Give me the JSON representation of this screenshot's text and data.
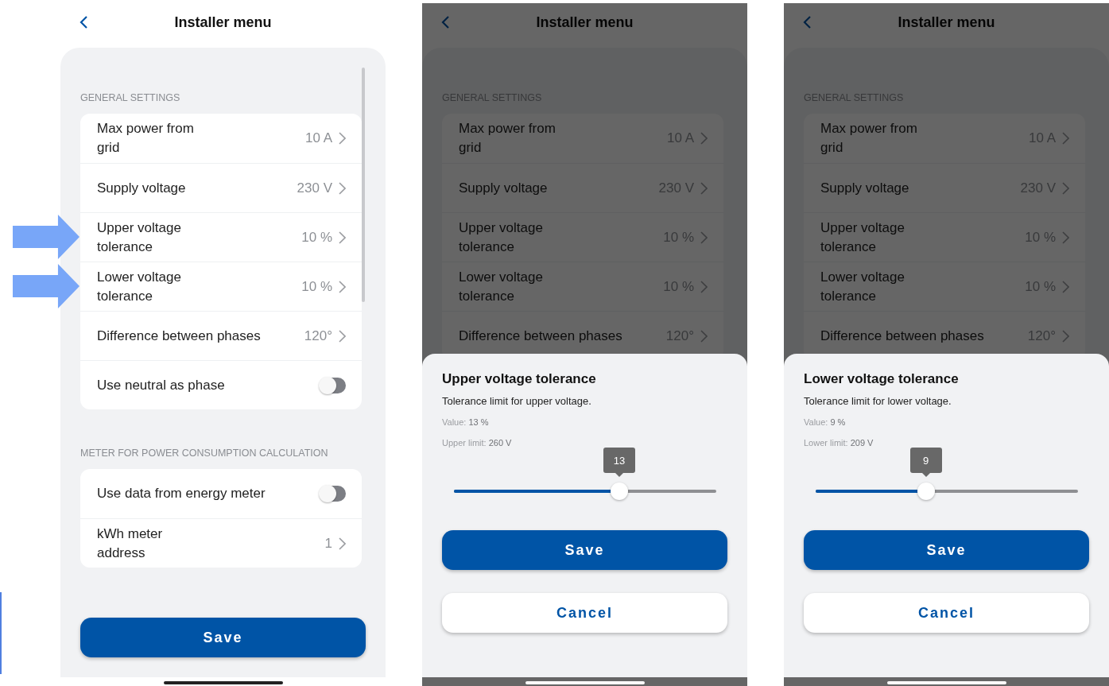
{
  "screens": [
    {
      "kind": "list",
      "title": "Installer menu",
      "sections": [
        {
          "label": "GENERAL SETTINGS",
          "rows": [
            {
              "kind": "value",
              "label": "Max power from\ngrid",
              "value": "10 A",
              "highlighted": false
            },
            {
              "kind": "value",
              "label": "Supply voltage",
              "value": "230 V",
              "highlighted": false
            },
            {
              "kind": "value",
              "label": "Upper voltage\ntolerance",
              "value": "10 %",
              "highlighted": true
            },
            {
              "kind": "value",
              "label": "Lower voltage\ntolerance",
              "value": "10 %",
              "highlighted": true
            },
            {
              "kind": "value",
              "label": "Difference between phases",
              "value": "120°",
              "highlighted": false
            },
            {
              "kind": "toggle",
              "label": "Use neutral as phase",
              "on": false,
              "highlighted": false
            }
          ]
        },
        {
          "label": "METER FOR POWER CONSUMPTION CALCULATION",
          "rows": [
            {
              "kind": "toggle",
              "label": "Use data from energy meter",
              "on": false,
              "highlighted": false
            },
            {
              "kind": "value",
              "label": "kWh meter\naddress",
              "value": "1",
              "highlighted": false
            }
          ]
        }
      ],
      "save_button": "Save"
    },
    {
      "kind": "sheet",
      "title": "Installer menu",
      "sections": [
        {
          "label": "GENERAL SETTINGS",
          "rows": [
            {
              "kind": "value",
              "label": "Max power from\ngrid",
              "value": "10 A",
              "highlighted": false
            },
            {
              "kind": "value",
              "label": "Supply voltage",
              "value": "230 V",
              "highlighted": false
            },
            {
              "kind": "value",
              "label": "Upper voltage\ntolerance",
              "value": "10 %",
              "highlighted": false
            },
            {
              "kind": "value",
              "label": "Lower voltage\ntolerance",
              "value": "10 %",
              "highlighted": false
            },
            {
              "kind": "value",
              "label": "Difference between phases",
              "value": "120°",
              "highlighted": false
            }
          ]
        }
      ],
      "sheet": {
        "title": "Upper voltage tolerance",
        "description": "Tolerance limit for upper voltage.",
        "value_text": "Value: **13 %**",
        "limit_text": "Upper limit: **260 V**",
        "slider": {
          "level": 0.63,
          "tooltip": "13"
        },
        "save_button": "Save",
        "cancel_button": "Cancel"
      }
    },
    {
      "kind": "sheet",
      "title": "Installer menu",
      "sections": [
        {
          "label": "GENERAL SETTINGS",
          "rows": [
            {
              "kind": "value",
              "label": "Max power from\ngrid",
              "value": "10 A",
              "highlighted": false
            },
            {
              "kind": "value",
              "label": "Supply voltage",
              "value": "230 V",
              "highlighted": false
            },
            {
              "kind": "value",
              "label": "Upper voltage\ntolerance",
              "value": "10 %",
              "highlighted": false
            },
            {
              "kind": "value",
              "label": "Lower voltage\ntolerance",
              "value": "10 %",
              "highlighted": false
            },
            {
              "kind": "value",
              "label": "Difference between phases",
              "value": "120°",
              "highlighted": false
            }
          ]
        }
      ],
      "sheet": {
        "title": "Lower voltage tolerance",
        "description": "Tolerance limit for lower voltage.",
        "value_text": "Value: **9 %**",
        "limit_text": "Lower limit: **209 V**",
        "slider": {
          "level": 0.42,
          "tooltip": "9"
        },
        "save_button": "Save",
        "cancel_button": "Cancel"
      }
    }
  ]
}
